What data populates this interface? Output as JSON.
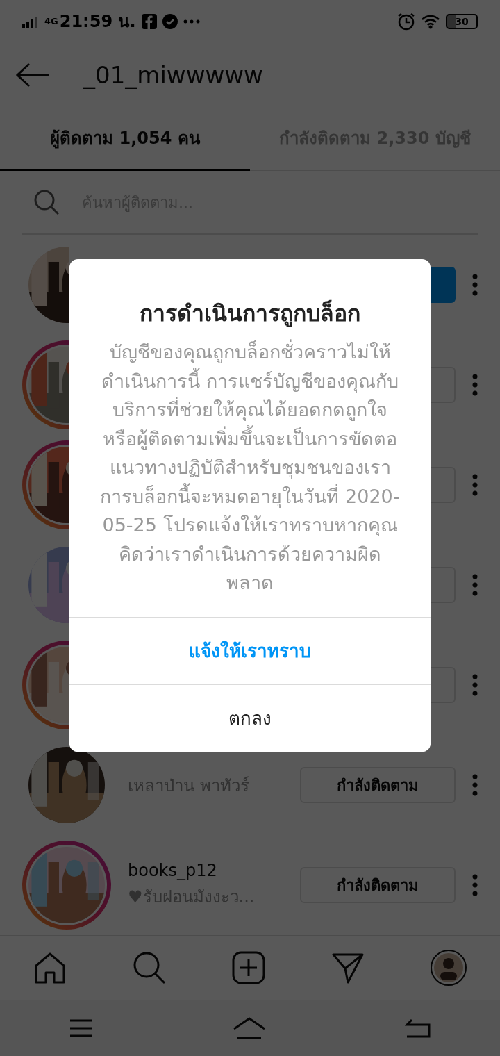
{
  "status_bar": {
    "network": "4G",
    "time": "21:59 น.",
    "battery": "30"
  },
  "header": {
    "title": "_01_miwwwww"
  },
  "tabs": [
    {
      "label": "ผู้ติดตาม 1,054 คน",
      "selected": true
    },
    {
      "label": "กำลังติดตาม 2,330 บัญชี",
      "selected": false
    }
  ],
  "search": {
    "placeholder": "ค้นหาผู้ติดตาม..."
  },
  "followers": [
    {
      "story": false,
      "button_filled": true
    },
    {
      "story": true,
      "button_filled": false
    },
    {
      "story": true,
      "button_filled": false
    },
    {
      "story": false,
      "button_filled": false
    },
    {
      "story": true,
      "button_filled": false
    },
    {
      "story": false,
      "subtitle": "เหลาป่าน พาทัวร์",
      "button_label": "กำลังติดตาม",
      "button_filled": false
    },
    {
      "story": true,
      "username": "books_p12",
      "subtitle": "♥รับฝอนมังงะว...",
      "button_label": "กำลังติดตาม",
      "button_filled": false
    }
  ],
  "dialog": {
    "title": "การดำเนินการถูกบล็อก",
    "message": "บัญชีของคุณถูกบล็อกชั่วคราวไม่ให้ดำเนินการนี้ การแชร์บัญชีของคุณกับบริการที่ช่วยให้คุณได้ยอดกดถูกใจหรือผู้ติดตามเพิ่มขึ้นจะเป็นการขัดตอแนวทางปฏิบัติสำหรับชุมชนของเรา การบล็อกนี้จะหมดอายุในวันที่ 2020-05-25 โปรดแจ้งให้เราทราบหากคุณคิดว่าเราดำเนินการด้วยความผิดพลาด",
    "actions": [
      {
        "label": "แจ้งให้เราทราบ",
        "kind": "primary"
      },
      {
        "label": "ตกลง",
        "kind": "default"
      }
    ]
  }
}
